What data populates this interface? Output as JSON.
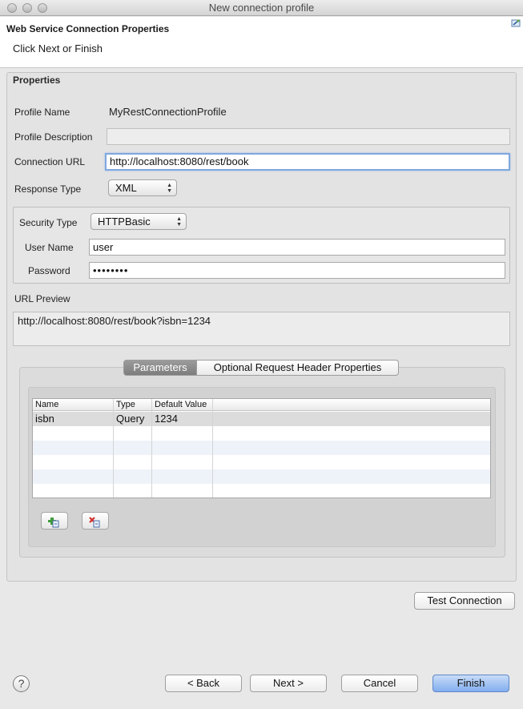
{
  "window": {
    "title": "New connection profile"
  },
  "header": {
    "title": "Web Service Connection Properties",
    "subtitle": "Click Next or Finish",
    "icon": "wizard-banner-icon"
  },
  "properties": {
    "group_title": "Properties",
    "profile_name_label": "Profile Name",
    "profile_name_value": "MyRestConnectionProfile",
    "profile_description_label": "Profile Description",
    "profile_description_value": "",
    "connection_url_label": "Connection URL",
    "connection_url_value": "http://localhost:8080/rest/book",
    "response_type_label": "Response Type",
    "response_type_value": "XML"
  },
  "security": {
    "security_type_label": "Security Type",
    "security_type_value": "HTTPBasic",
    "user_name_label": "User Name",
    "user_name_value": "user",
    "password_label": "Password",
    "password_value": "••••••••"
  },
  "url_preview": {
    "label": "URL Preview",
    "value": "http://localhost:8080/rest/book?isbn=1234"
  },
  "tabs": [
    {
      "label": "Parameters",
      "active": true
    },
    {
      "label": "Optional Request Header Properties",
      "active": false
    }
  ],
  "parameters_table": {
    "columns": [
      "Name",
      "Type",
      "Default Value"
    ],
    "rows": [
      {
        "name": "isbn",
        "type": "Query",
        "default_value": "1234"
      }
    ]
  },
  "table_buttons": {
    "add_icon": "add-row-icon",
    "remove_icon": "remove-row-icon"
  },
  "buttons": {
    "test_connection": "Test Connection",
    "back": "< Back",
    "next": "Next >",
    "cancel": "Cancel",
    "finish": "Finish",
    "help": "?"
  },
  "colors": {
    "primary_button": "#82aef0",
    "active_tab": "#7d7d7d",
    "focus_ring": "#7fa8e0"
  }
}
